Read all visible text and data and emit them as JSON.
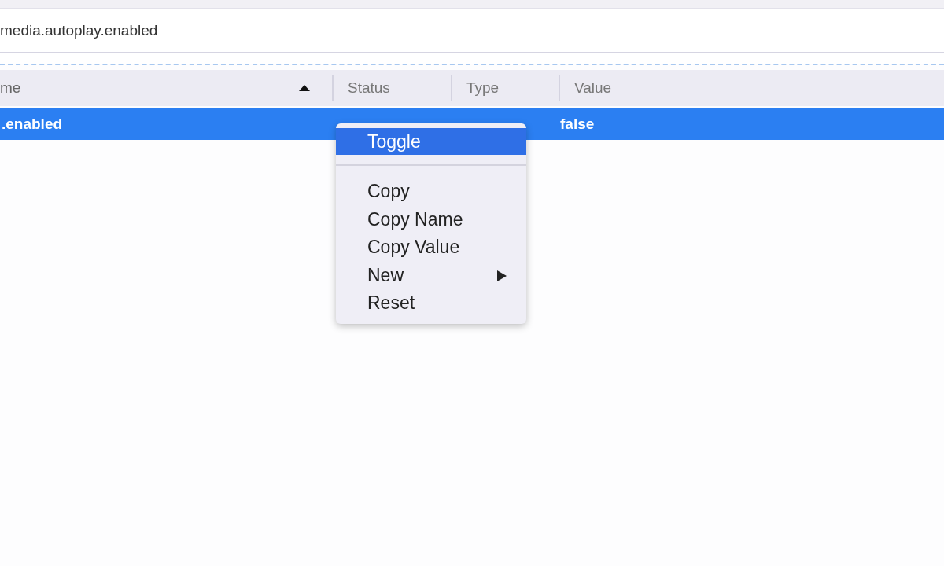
{
  "search": {
    "value": "media.autoplay.enabled"
  },
  "table": {
    "columns": [
      {
        "label": "me",
        "sorted": true
      },
      {
        "label": "Status",
        "sorted": false
      },
      {
        "label": "Type",
        "sorted": false
      },
      {
        "label": "Value",
        "sorted": false
      }
    ],
    "rows": [
      {
        "selected": true,
        "name": ".enabled",
        "value": "false"
      }
    ]
  },
  "context_menu": {
    "items": [
      {
        "kind": "item",
        "label": "Toggle",
        "selected": true,
        "submenu": false
      },
      {
        "kind": "separator"
      },
      {
        "kind": "item",
        "label": "Copy",
        "selected": false,
        "submenu": false
      },
      {
        "kind": "item",
        "label": "Copy Name",
        "selected": false,
        "submenu": false
      },
      {
        "kind": "item",
        "label": "Copy Value",
        "selected": false,
        "submenu": false
      },
      {
        "kind": "item",
        "label": "New",
        "selected": false,
        "submenu": true
      },
      {
        "kind": "item",
        "label": "Reset",
        "selected": false,
        "submenu": false
      }
    ]
  }
}
